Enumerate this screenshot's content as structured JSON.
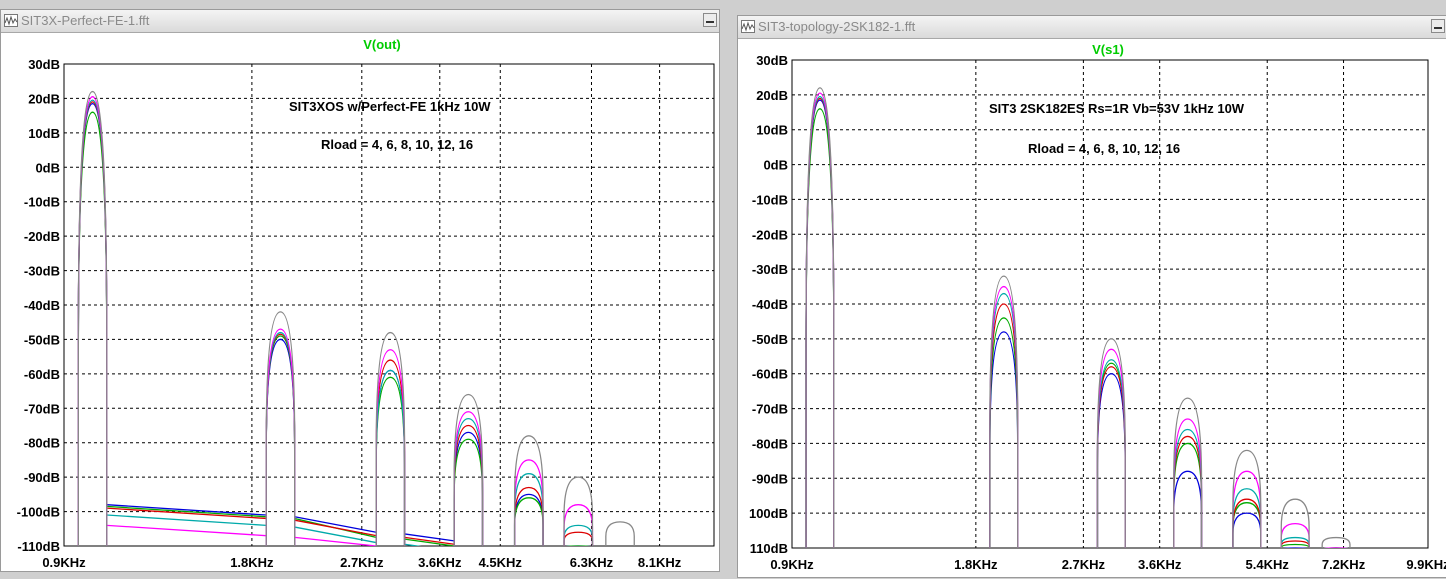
{
  "windows": [
    {
      "title": "SIT3X-Perfect-FE-1.fft"
    },
    {
      "title": "SIT3-topology-2SK182-1.fft"
    }
  ],
  "chart_data": [
    {
      "type": "line",
      "title": "V(out)",
      "annotations": [
        "SIT3XOS w/Perfect-FE  1kHz 10W",
        "Rload = 4, 6, 8, 10, 12, 16"
      ],
      "y_ticks": [
        "30dB",
        "20dB",
        "10dB",
        "0dB",
        "-10dB",
        "-20dB",
        "-30dB",
        "-40dB",
        "-50dB",
        "-60dB",
        "-70dB",
        "-80dB",
        "-90dB",
        "-100dB",
        "-110dB"
      ],
      "x_ticks": [
        "0.9KHz",
        "1.8KHz",
        "2.7KHz",
        "3.6KHz",
        "4.5KHz",
        "6.3KHz",
        "8.1KHz"
      ],
      "x_tick_values": [
        0.9,
        1.8,
        2.7,
        3.6,
        4.5,
        6.3,
        8.1
      ],
      "x_scale": "log",
      "xlim": [
        0.9,
        9.9
      ],
      "ylim": [
        -110,
        30
      ],
      "grid": true,
      "series": [
        {
          "color": "#0000dd",
          "peaks": [
            18.5,
            -50,
            -59,
            -77,
            -95,
            -110
          ],
          "noise": [
            -98,
            -106
          ]
        },
        {
          "color": "#00aa00",
          "peaks": [
            16,
            -49,
            -61,
            -79,
            -96,
            -110
          ],
          "noise": [
            -98.5,
            -107.5
          ]
        },
        {
          "color": "#dd0000",
          "peaks": [
            19,
            -48.5,
            -56,
            -75,
            -93,
            -106
          ],
          "noise": [
            -99,
            -107
          ]
        },
        {
          "color": "#00aaaa",
          "peaks": [
            19.5,
            -48,
            -59,
            -73,
            -89,
            -104
          ],
          "noise": [
            -101,
            -109
          ]
        },
        {
          "color": "#ff00ff",
          "peaks": [
            20.5,
            -47,
            -53,
            -71,
            -85,
            -98
          ],
          "noise": [
            -104,
            -110
          ]
        },
        {
          "color": "#888888",
          "peaks": [
            22,
            -42,
            -48,
            -66,
            -78,
            -90,
            -103
          ],
          "noise": []
        }
      ],
      "harmonics_khz": [
        1,
        2,
        3,
        4,
        5,
        6,
        7
      ]
    },
    {
      "type": "line",
      "title": "V(s1)",
      "annotations": [
        "SIT3 2SK182ES Rs=1R Vb=53V 1kHz 10W",
        "Rload = 4, 6, 8, 10, 12, 16"
      ],
      "y_ticks": [
        "30dB",
        "20dB",
        "10dB",
        "0dB",
        "-10dB",
        "-20dB",
        "-30dB",
        "-40dB",
        "-50dB",
        "-60dB",
        "-70dB",
        "-80dB",
        "-90dB",
        "100dB",
        "110dB"
      ],
      "x_ticks": [
        "0.9KHz",
        "1.8KHz",
        "2.7KHz",
        "3.6KHz",
        "5.4KHz",
        "7.2KHz",
        "9.9KHz"
      ],
      "x_tick_values": [
        0.9,
        1.8,
        2.7,
        3.6,
        5.4,
        7.2,
        9.9
      ],
      "x_scale": "log",
      "xlim": [
        0.9,
        9.9
      ],
      "ylim": [
        -110,
        30
      ],
      "grid": true,
      "series": [
        {
          "color": "#0000dd",
          "peaks": [
            18.5,
            -48,
            -60,
            -88,
            -100,
            -110,
            -110
          ]
        },
        {
          "color": "#00aa00",
          "peaks": [
            16,
            -44,
            -57,
            -80,
            -97,
            -109,
            -110
          ]
        },
        {
          "color": "#dd0000",
          "peaks": [
            19,
            -40,
            -58,
            -78,
            -96,
            -108,
            -110
          ]
        },
        {
          "color": "#00aaaa",
          "peaks": [
            19.5,
            -37,
            -56,
            -76,
            -93,
            -107,
            -110
          ]
        },
        {
          "color": "#ff00ff",
          "peaks": [
            20.5,
            -35,
            -53,
            -73,
            -88,
            -103,
            -110
          ]
        },
        {
          "color": "#888888",
          "peaks": [
            22,
            -32,
            -50,
            -67,
            -82,
            -96,
            -107
          ]
        }
      ],
      "harmonics_khz": [
        1,
        2,
        3,
        4,
        5,
        6,
        7
      ]
    }
  ]
}
